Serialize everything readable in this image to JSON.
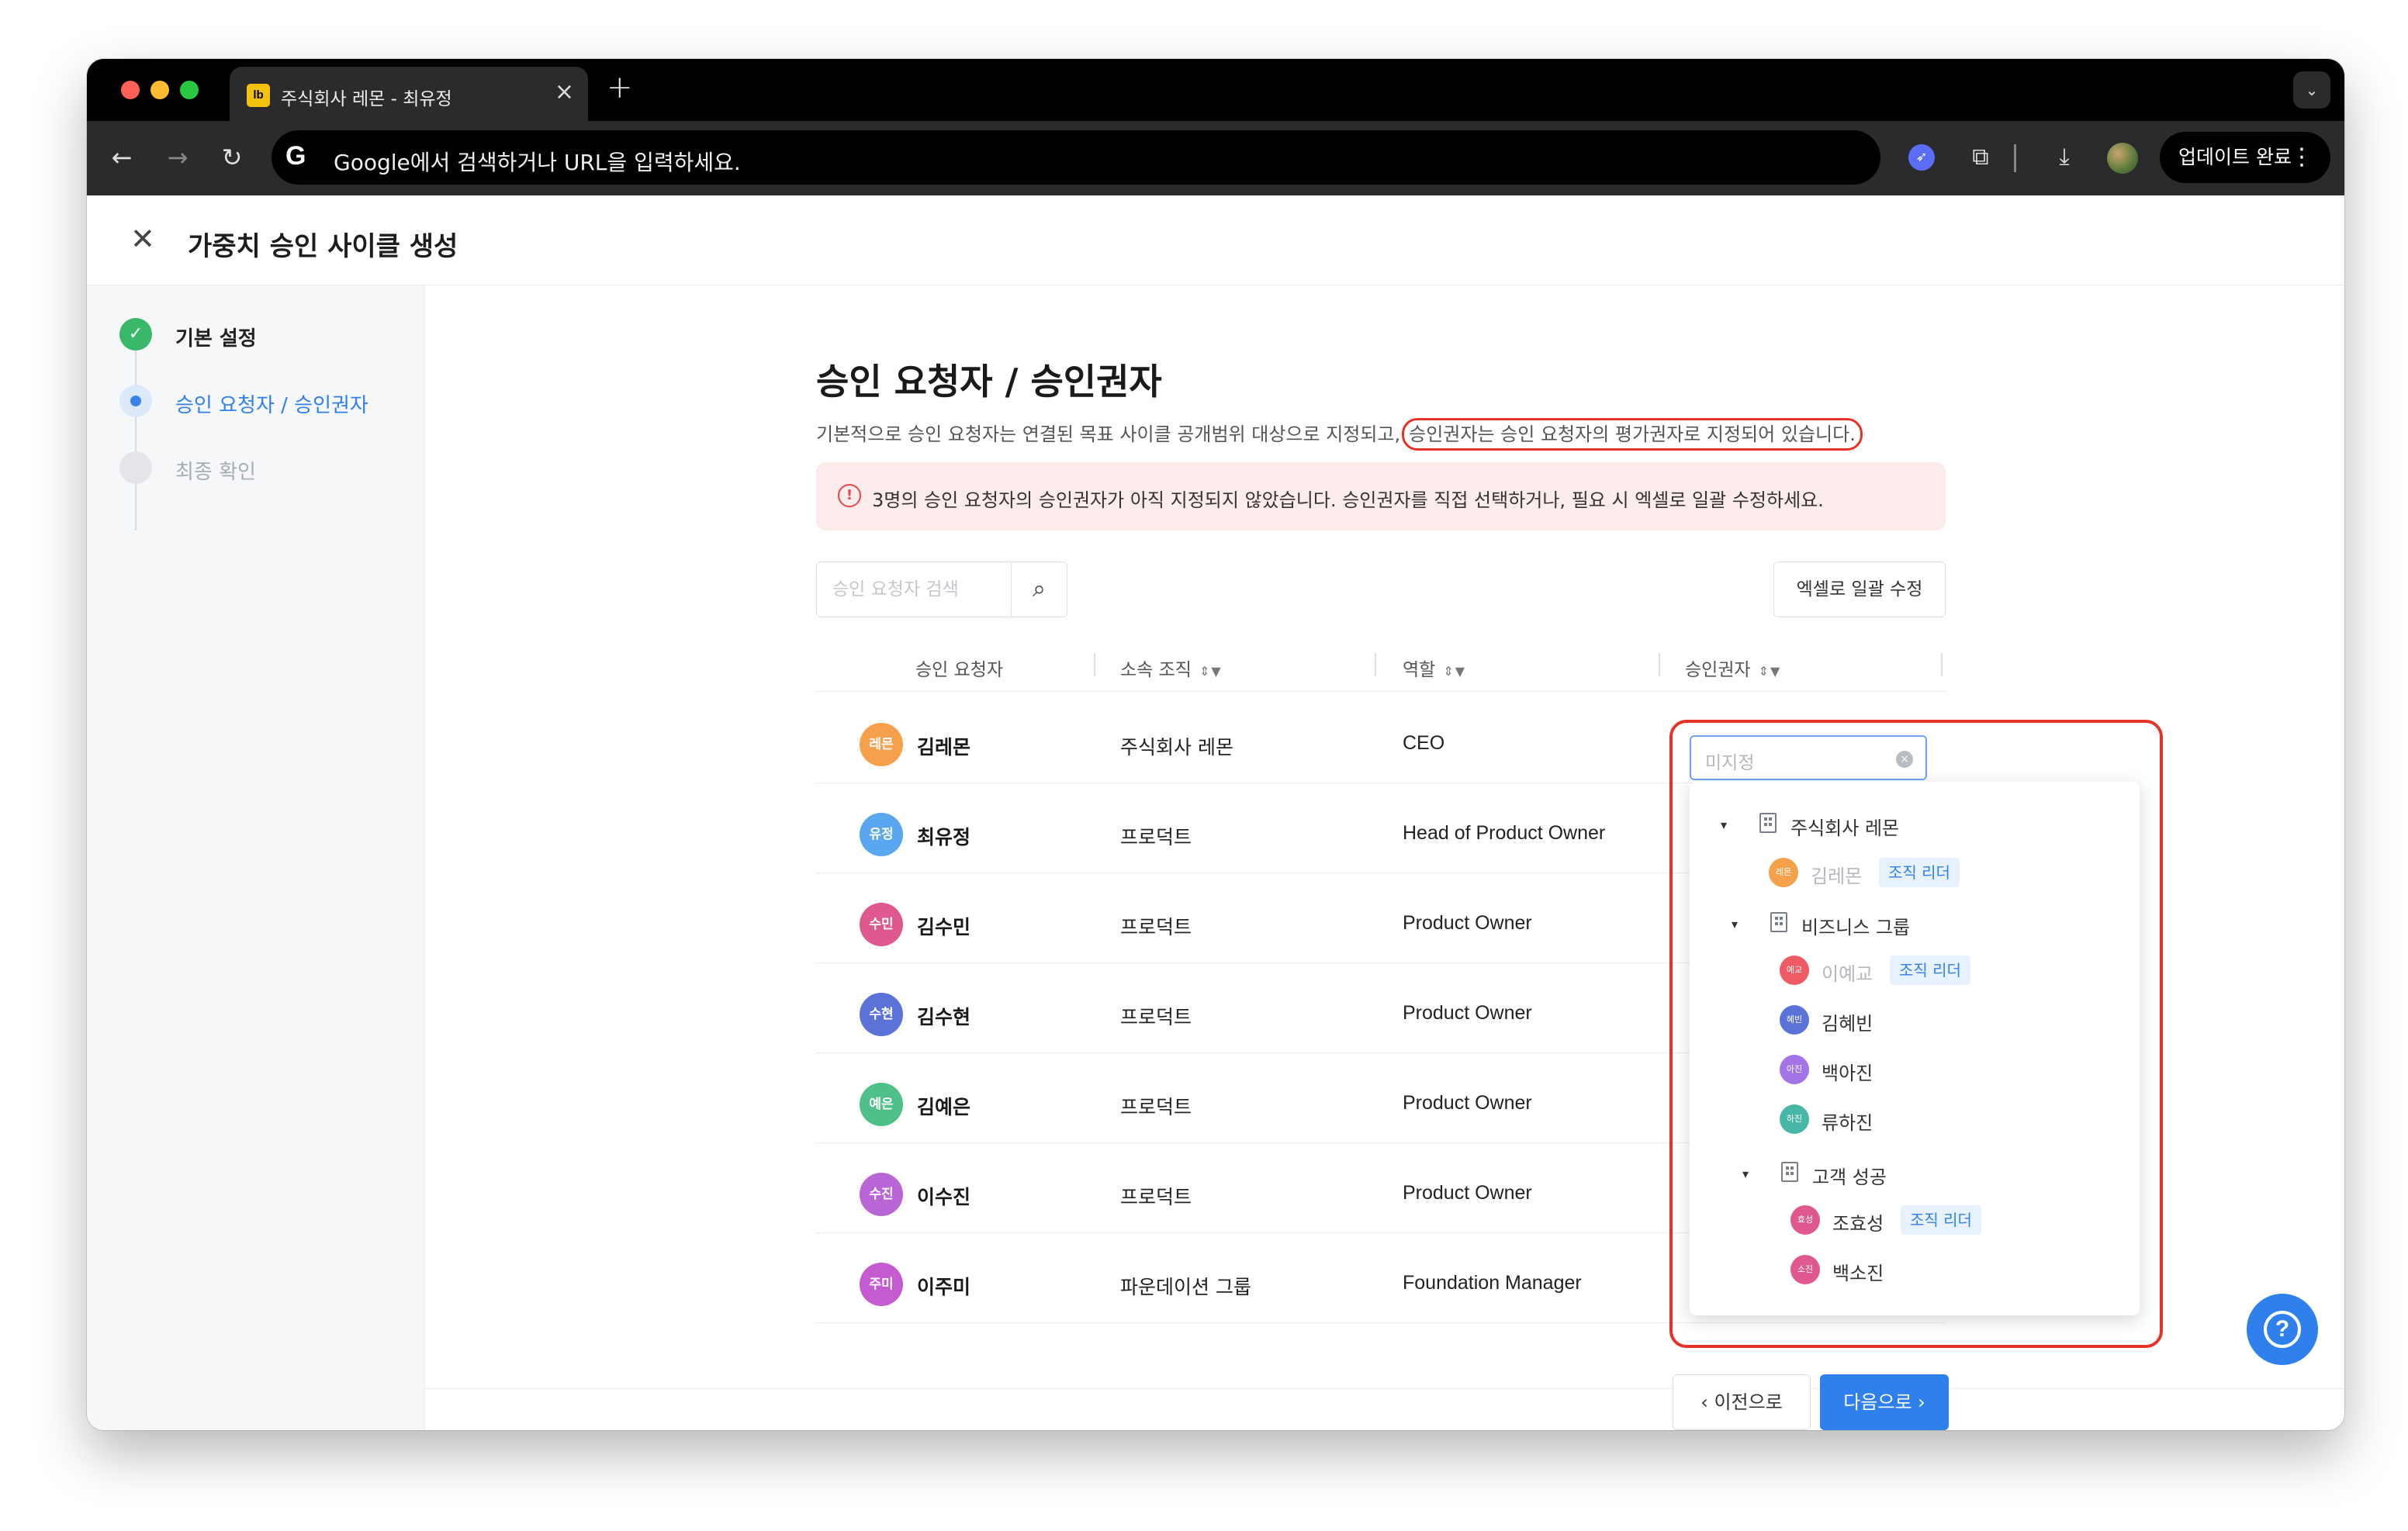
{
  "browser": {
    "tab_title": "주식회사 레몬 - 최유정",
    "tab_favicon": "lb",
    "address_placeholder": "Google에서 검색하거나 URL을 입력하세요.",
    "update_label": "업데이트 완료"
  },
  "page": {
    "title": "가중치 승인 사이클 생성",
    "steps": [
      {
        "label": "기본 설정",
        "state": "done"
      },
      {
        "label": "승인 요청자 / 승인권자",
        "state": "active"
      },
      {
        "label": "최종 확인",
        "state": "pending"
      }
    ],
    "heading": "승인 요청자 / 승인권자",
    "description_prefix": "기본적으로 승인 요청자는 연결된 목표 사이클 공개범위 대상으로 지정되고,",
    "description_highlight": "승인권자는 승인 요청자의 평가권자로 지정되어 있습니다.",
    "alert": "3명의 승인 요청자의 승인권자가 아직 지정되지 않았습니다. 승인권자를 직접 선택하거나, 필요 시 엑셀로 일괄 수정하세요.",
    "search_placeholder": "승인 요청자 검색",
    "excel_button": "엑셀로 일괄 수정",
    "columns": {
      "requester": "승인 요청자",
      "org": "소속 조직",
      "role": "역할",
      "approver": "승인권자"
    },
    "rows": [
      {
        "avatar": "레몬",
        "name": "김레몬",
        "org": "주식회사 레몬",
        "role": "CEO",
        "color": "#f5a04a"
      },
      {
        "avatar": "유정",
        "name": "최유정",
        "org": "프로덕트",
        "role": "Head of Product Owner",
        "color": "#5aa7f0"
      },
      {
        "avatar": "수민",
        "name": "김수민",
        "org": "프로덕트",
        "role": "Product Owner",
        "color": "#e0598e"
      },
      {
        "avatar": "수현",
        "name": "김수현",
        "org": "프로덕트",
        "role": "Product Owner",
        "color": "#5b72d8"
      },
      {
        "avatar": "예은",
        "name": "김예은",
        "org": "프로덕트",
        "role": "Product Owner",
        "color": "#4fc08a"
      },
      {
        "avatar": "수진",
        "name": "이수진",
        "org": "프로덕트",
        "role": "Product Owner",
        "color": "#b866d6"
      },
      {
        "avatar": "주미",
        "name": "이주미",
        "org": "파운데이션 그룹",
        "role": "Foundation Manager",
        "color": "#c45bd0"
      }
    ],
    "approver_select": {
      "placeholder": "미지정",
      "tree": {
        "orgs": [
          {
            "name": "주식회사 레몬",
            "members": [
              {
                "avatar": "레몬",
                "name": "김레몬",
                "badge": "조직 리더",
                "color": "#f5a04a"
              }
            ]
          },
          {
            "name": "비즈니스 그룹",
            "members": [
              {
                "avatar": "예교",
                "name": "이예교",
                "badge": "조직 리더",
                "color": "#ef5b64"
              },
              {
                "avatar": "혜빈",
                "name": "김혜빈",
                "color": "#5b72d8"
              },
              {
                "avatar": "아진",
                "name": "백아진",
                "color": "#a374e6"
              },
              {
                "avatar": "하진",
                "name": "류하진",
                "color": "#49b7a8"
              }
            ]
          },
          {
            "name": "고객 성공",
            "members": [
              {
                "avatar": "효성",
                "name": "조효성",
                "badge": "조직 리더",
                "color": "#e0598e"
              },
              {
                "avatar": "소진",
                "name": "백소진",
                "color": "#e0598e"
              }
            ]
          }
        ]
      }
    },
    "prev_button": "이전으로",
    "next_button": "다음으로"
  },
  "icons": {
    "close": "close-icon",
    "search": "search-icon",
    "help": "help-icon",
    "building": "building-icon"
  }
}
